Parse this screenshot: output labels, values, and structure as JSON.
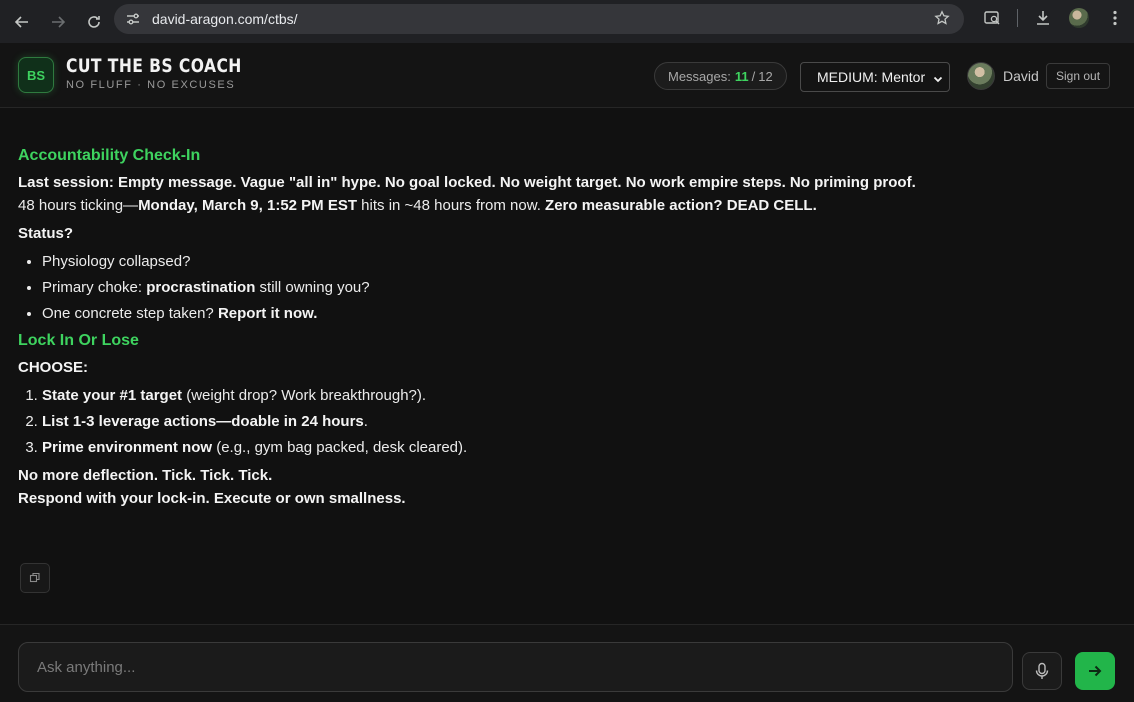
{
  "browser": {
    "url": "david-aragon.com/ctbs/",
    "icons": [
      "back-icon",
      "forward-icon",
      "reload-icon",
      "site-settings-icon",
      "star-icon",
      "tab-search-icon",
      "download-icon",
      "profile-icon",
      "menu-icon"
    ]
  },
  "header": {
    "logo_text": "BS",
    "title": "CUT THE BS COACH",
    "subtitle": "NO FLUFF · NO EXCUSES",
    "messages_label": "Messages:",
    "messages_used": "11",
    "messages_total": "12",
    "mode": "MEDIUM: Mentor",
    "user_name": "David",
    "signout_label": "Sign out"
  },
  "message": {
    "section1_title": "Accountability Check-In",
    "line1": "Last session: Empty message. Vague \"all in\" hype. No goal locked. No weight target. No work empire steps. No priming proof.",
    "line2_a": "48 hours ticking—",
    "line2_b": "Monday, March 9, 1:52 PM EST",
    "line2_c": " hits in ~48 hours from now. ",
    "line2_d": "Zero measurable action? DEAD CELL.",
    "status": "Status?",
    "bullet1": "Physiology collapsed?",
    "bullet2_a": "Primary choke: ",
    "bullet2_b": "procrastination",
    "bullet2_c": " still owning you?",
    "bullet3_a": "One concrete step taken? ",
    "bullet3_b": "Report it now.",
    "section2_title": "Lock In Or Lose",
    "choose": "CHOOSE:",
    "item1_a": "State your #1 target",
    "item1_b": " (weight drop? Work breakthrough?).",
    "item2_a": "List 1-3 leverage actions—doable in 24 hours",
    "item2_b": ".",
    "item3_a": "Prime environment now",
    "item3_b": " (e.g., gym bag packed, desk cleared).",
    "closing1": "No more deflection. Tick. Tick. Tick.",
    "closing2": "Respond with your lock-in. Execute or own smallness."
  },
  "composer": {
    "placeholder": "Ask anything..."
  },
  "colors": {
    "accent": "#3ed35f",
    "send_button": "#22b54a",
    "background": "#111111"
  }
}
